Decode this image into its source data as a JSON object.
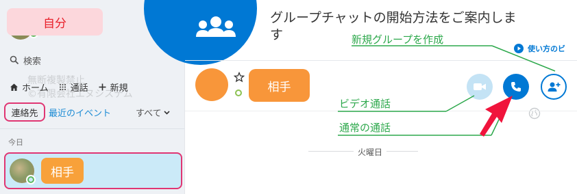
{
  "sidebar": {
    "self_name": "自分",
    "search_label": "検索",
    "nav": [
      {
        "label": "ホーム"
      },
      {
        "label": "通話"
      },
      {
        "label": "新規"
      }
    ],
    "watermark": [
      "無断複製禁止",
      "©有限会社エヌシステム"
    ],
    "filter": {
      "contacts": "連絡先",
      "recent": "最近のイベント",
      "all": "すべて"
    },
    "section_today": "今日",
    "contact_name": "相手"
  },
  "banner": {
    "title": "グループチャットの開始方法をご案内します",
    "howto_link": "使い方のビ",
    "annotation_new_group": "新規グループを作成"
  },
  "conversation": {
    "contact_name": "相手",
    "annotation_video": "ビデオ通話",
    "annotation_call": "通常の通話",
    "day_label": "火曜日"
  },
  "colors": {
    "brand_blue": "#0078d4",
    "highlight_pink": "#e03572",
    "annotation_green": "#2ca84b",
    "arrow_red": "#f0143c",
    "contact_orange": "#f8963a"
  }
}
